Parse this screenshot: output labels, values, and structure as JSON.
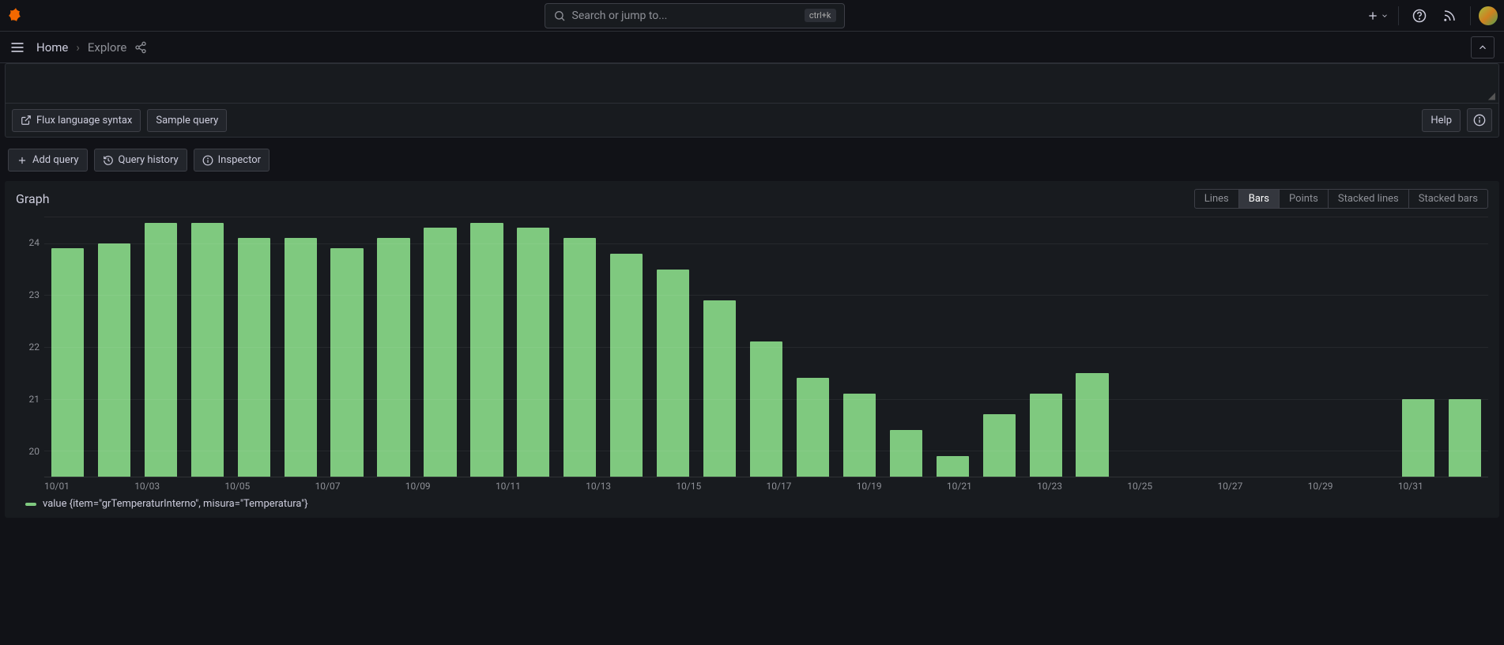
{
  "search": {
    "placeholder": "Search or jump to...",
    "shortcut": "ctrl+k"
  },
  "breadcrumb": {
    "home": "Home",
    "current": "Explore"
  },
  "query_footer": {
    "flux_link": "Flux language syntax",
    "sample_query": "Sample query",
    "help": "Help"
  },
  "buttons": {
    "add_query": "Add query",
    "query_history": "Query history",
    "inspector": "Inspector"
  },
  "graph": {
    "title": "Graph",
    "toggles": {
      "lines": "Lines",
      "bars": "Bars",
      "points": "Points",
      "stacked_lines": "Stacked lines",
      "stacked_bars": "Stacked bars"
    },
    "legend": "value {item=\"grTemperaturInterno\", misura=\"Temperatura\"}"
  },
  "chart_data": {
    "type": "bar",
    "y_ticks": [
      20,
      21,
      22,
      23,
      24
    ],
    "ylim": [
      19.5,
      24.5
    ],
    "x_ticks": [
      "10/01",
      "10/03",
      "10/05",
      "10/07",
      "10/09",
      "10/11",
      "10/13",
      "10/15",
      "10/17",
      "10/19",
      "10/21",
      "10/23",
      "10/25",
      "10/27",
      "10/29",
      "10/31"
    ],
    "categories": [
      "10/01",
      "10/02",
      "10/03",
      "10/04",
      "10/05",
      "10/06",
      "10/07",
      "10/08",
      "10/09",
      "10/10",
      "10/11",
      "10/12",
      "10/13",
      "10/14",
      "10/15",
      "10/16",
      "10/17",
      "10/18",
      "10/19",
      "10/20",
      "10/21",
      "10/22",
      "10/23",
      "10/24",
      "10/25",
      "10/26",
      "10/27",
      "10/28",
      "10/29",
      "10/30",
      "10/31"
    ],
    "values": [
      23.9,
      24.0,
      24.4,
      24.4,
      24.1,
      24.1,
      23.9,
      24.1,
      24.3,
      24.4,
      24.3,
      24.1,
      23.8,
      23.5,
      22.9,
      22.1,
      21.4,
      21.1,
      20.4,
      19.9,
      20.7,
      21.1,
      21.5,
      null,
      null,
      null,
      null,
      null,
      null,
      21.0,
      21.0
    ]
  }
}
